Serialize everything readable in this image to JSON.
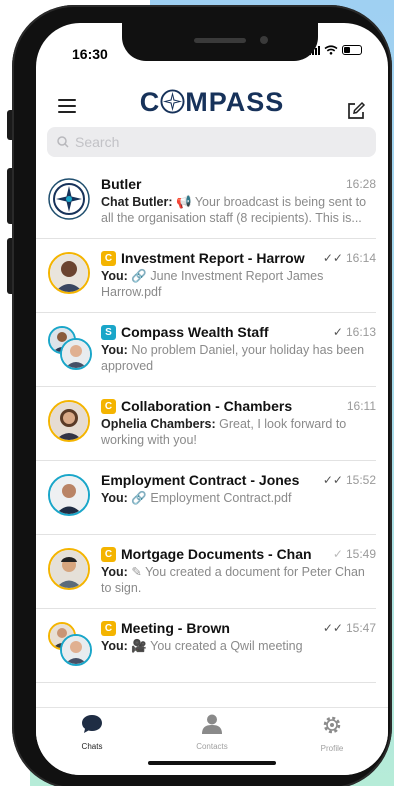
{
  "status_bar": {
    "time": "16:30"
  },
  "header": {
    "logo_pre": "C",
    "logo_post": "MPASS"
  },
  "search": {
    "placeholder": "Search"
  },
  "chats": [
    {
      "name": "Butler",
      "badge": "",
      "time": "16:28",
      "tick": "",
      "sender": "Chat Butler:",
      "icon": "📢",
      "text": "Your broadcast is being sent to all the organisation staff (8 recipients). This is..."
    },
    {
      "name": "Investment Report - Harrow",
      "badge": "C",
      "badge_color": "#f4b400",
      "time": "16:14",
      "tick": "✓✓",
      "sender": "You:",
      "icon": "🔗",
      "text": "June Investment Report James Harrow.pdf"
    },
    {
      "name": "Compass Wealth Staff",
      "badge": "S",
      "badge_color": "#1aa6c9",
      "time": "16:13",
      "tick": "✓",
      "sender": "You:",
      "icon": "",
      "text": "No problem Daniel, your holiday has been approved"
    },
    {
      "name": "Collaboration - Chambers",
      "badge": "C",
      "badge_color": "#f4b400",
      "time": "16:11",
      "tick": "",
      "sender": "Ophelia Chambers:",
      "icon": "",
      "text": "Great, I look forward to working with you!"
    },
    {
      "name": "Employment Contract - Jones",
      "badge": "",
      "time": "15:52",
      "tick": "✓✓",
      "sender": "You:",
      "icon": "🔗",
      "text": "Employment Contract.pdf"
    },
    {
      "name": "Mortgage Documents - Chan",
      "badge": "C",
      "badge_color": "#f4b400",
      "time": "15:49",
      "tick": "✓",
      "tick_grey": true,
      "sender": "You:",
      "icon": "✎",
      "text": "You created a document for Peter Chan to sign."
    },
    {
      "name": "Meeting - Brown",
      "badge": "C",
      "badge_color": "#f4b400",
      "time": "15:47",
      "tick": "✓✓",
      "sender": "You:",
      "icon": "🎥",
      "text": "You created a Qwil meeting"
    }
  ],
  "tabs": [
    {
      "label": "Chats"
    },
    {
      "label": "Contacts"
    },
    {
      "label": "Profile"
    }
  ],
  "colors": {
    "brand": "#17325a",
    "accent_yellow": "#f4b400",
    "accent_teal": "#1aa6c9"
  }
}
